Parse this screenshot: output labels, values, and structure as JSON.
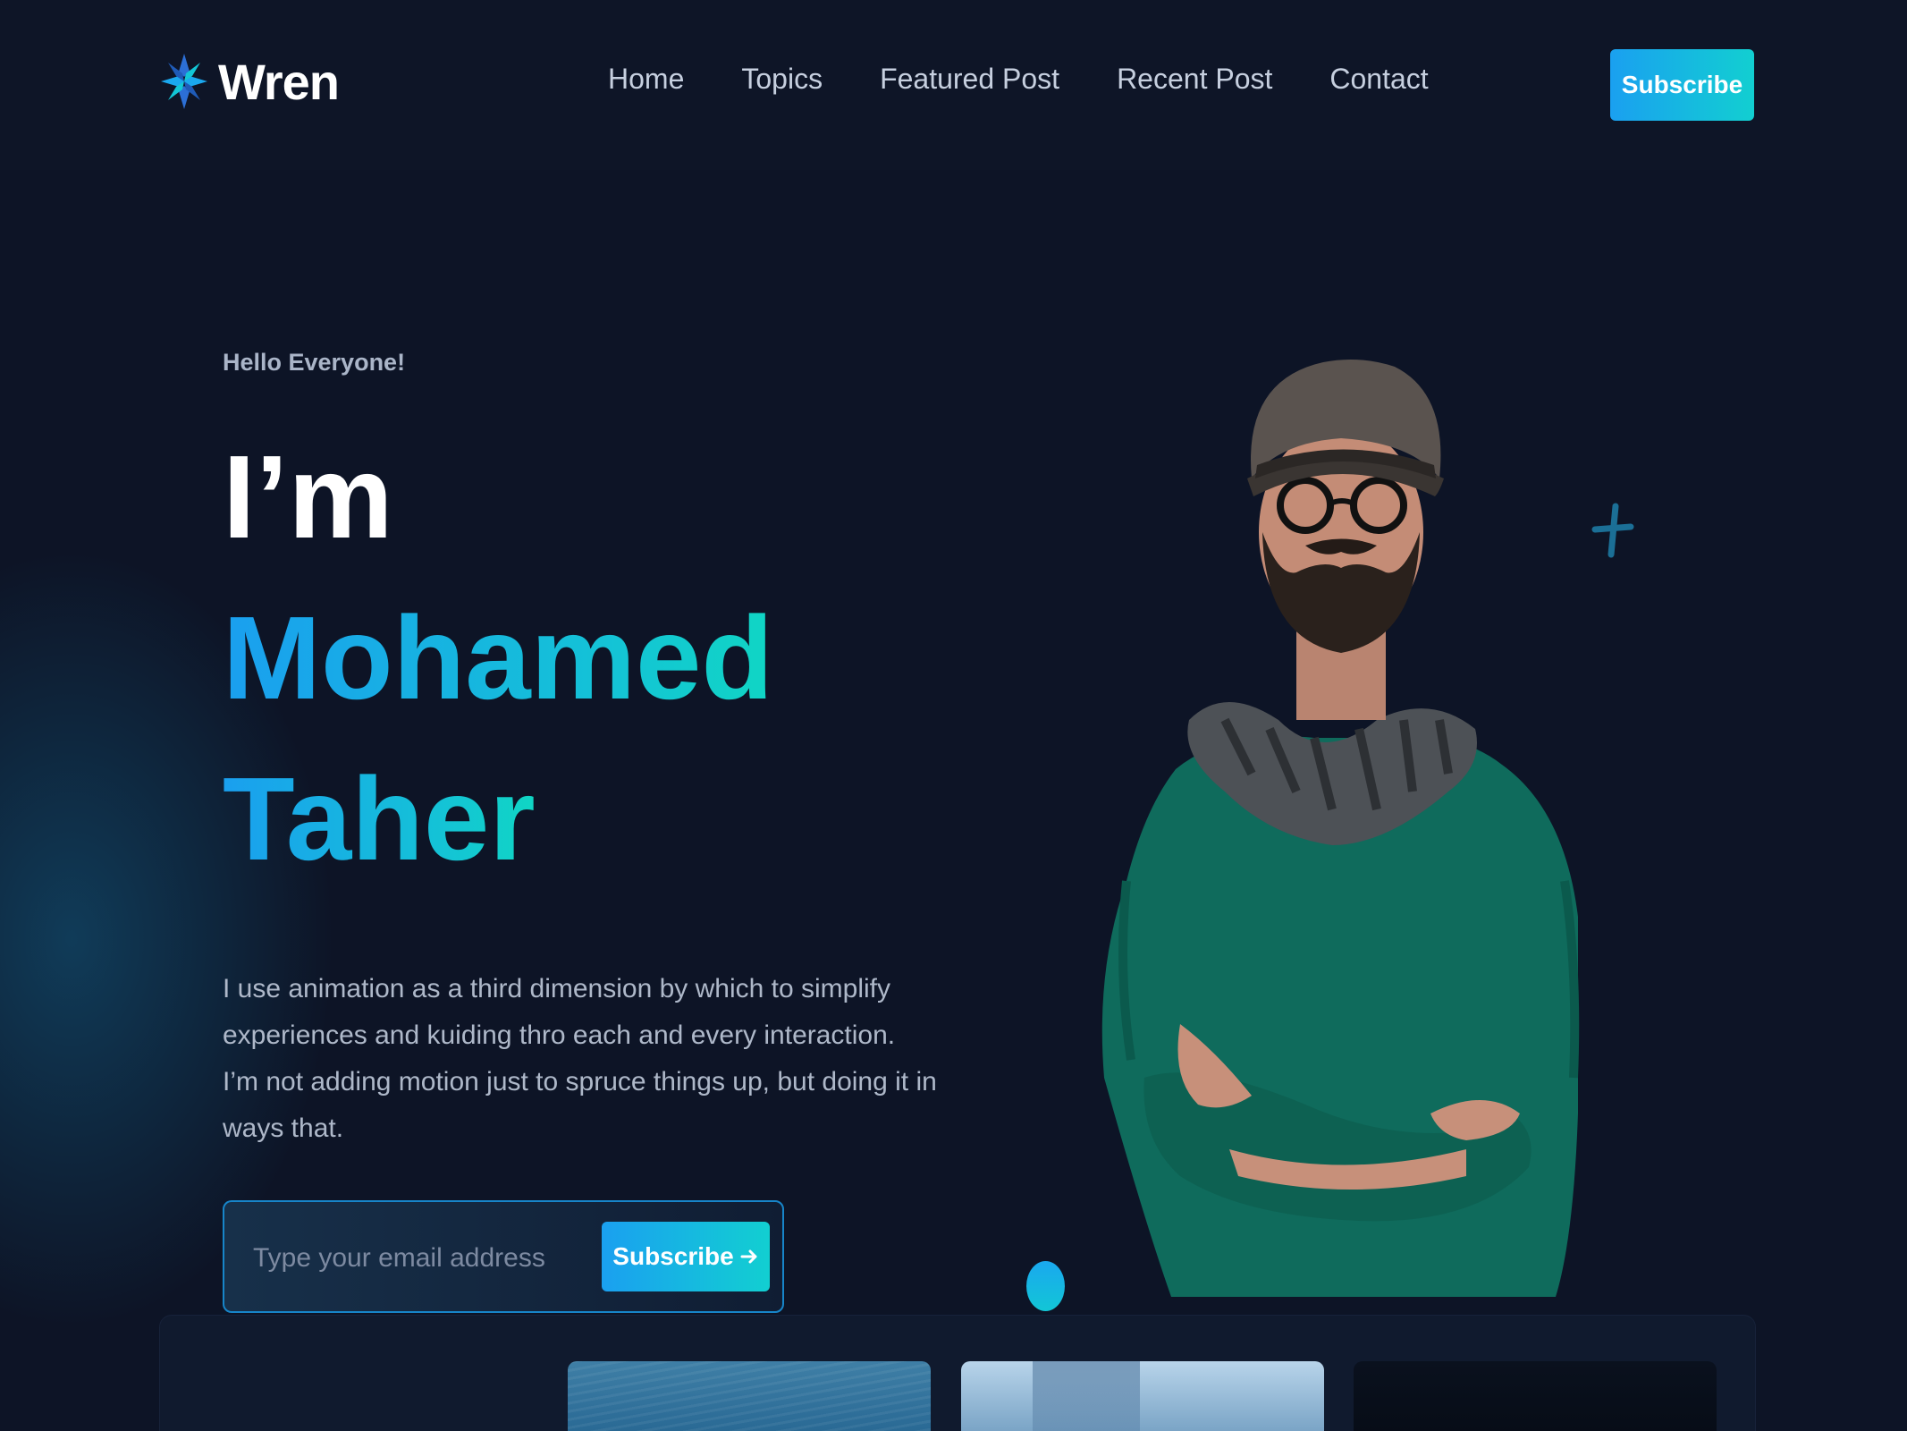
{
  "brand": {
    "name": "Wren",
    "logo_icon": "wren-star-logo-icon",
    "accent_start": "#1aa0f0",
    "accent_end": "#12cfd1",
    "background": "#0d1426"
  },
  "nav": {
    "items": [
      {
        "label": "Home"
      },
      {
        "label": "Topics"
      },
      {
        "label": "Featured Post"
      },
      {
        "label": "Recent Post"
      },
      {
        "label": "Contact"
      }
    ],
    "subscribe_label": "Subscribe"
  },
  "hero": {
    "greeting": "Hello Everyone!",
    "intro": "I’m",
    "name_line_1": "Mohamed",
    "name_line_2": "Taher",
    "description": "I use animation as a third dimension by which to simplify experiences and kuiding thro each and every interaction. I’m not adding motion just to spruce things up, but doing it in ways that.",
    "email_placeholder": "Type your email address",
    "form_subscribe_label": "Subscribe",
    "form_subscribe_icon": "arrow-right-icon",
    "portrait_icon": "portrait-man-hat-glasses-scarf"
  }
}
